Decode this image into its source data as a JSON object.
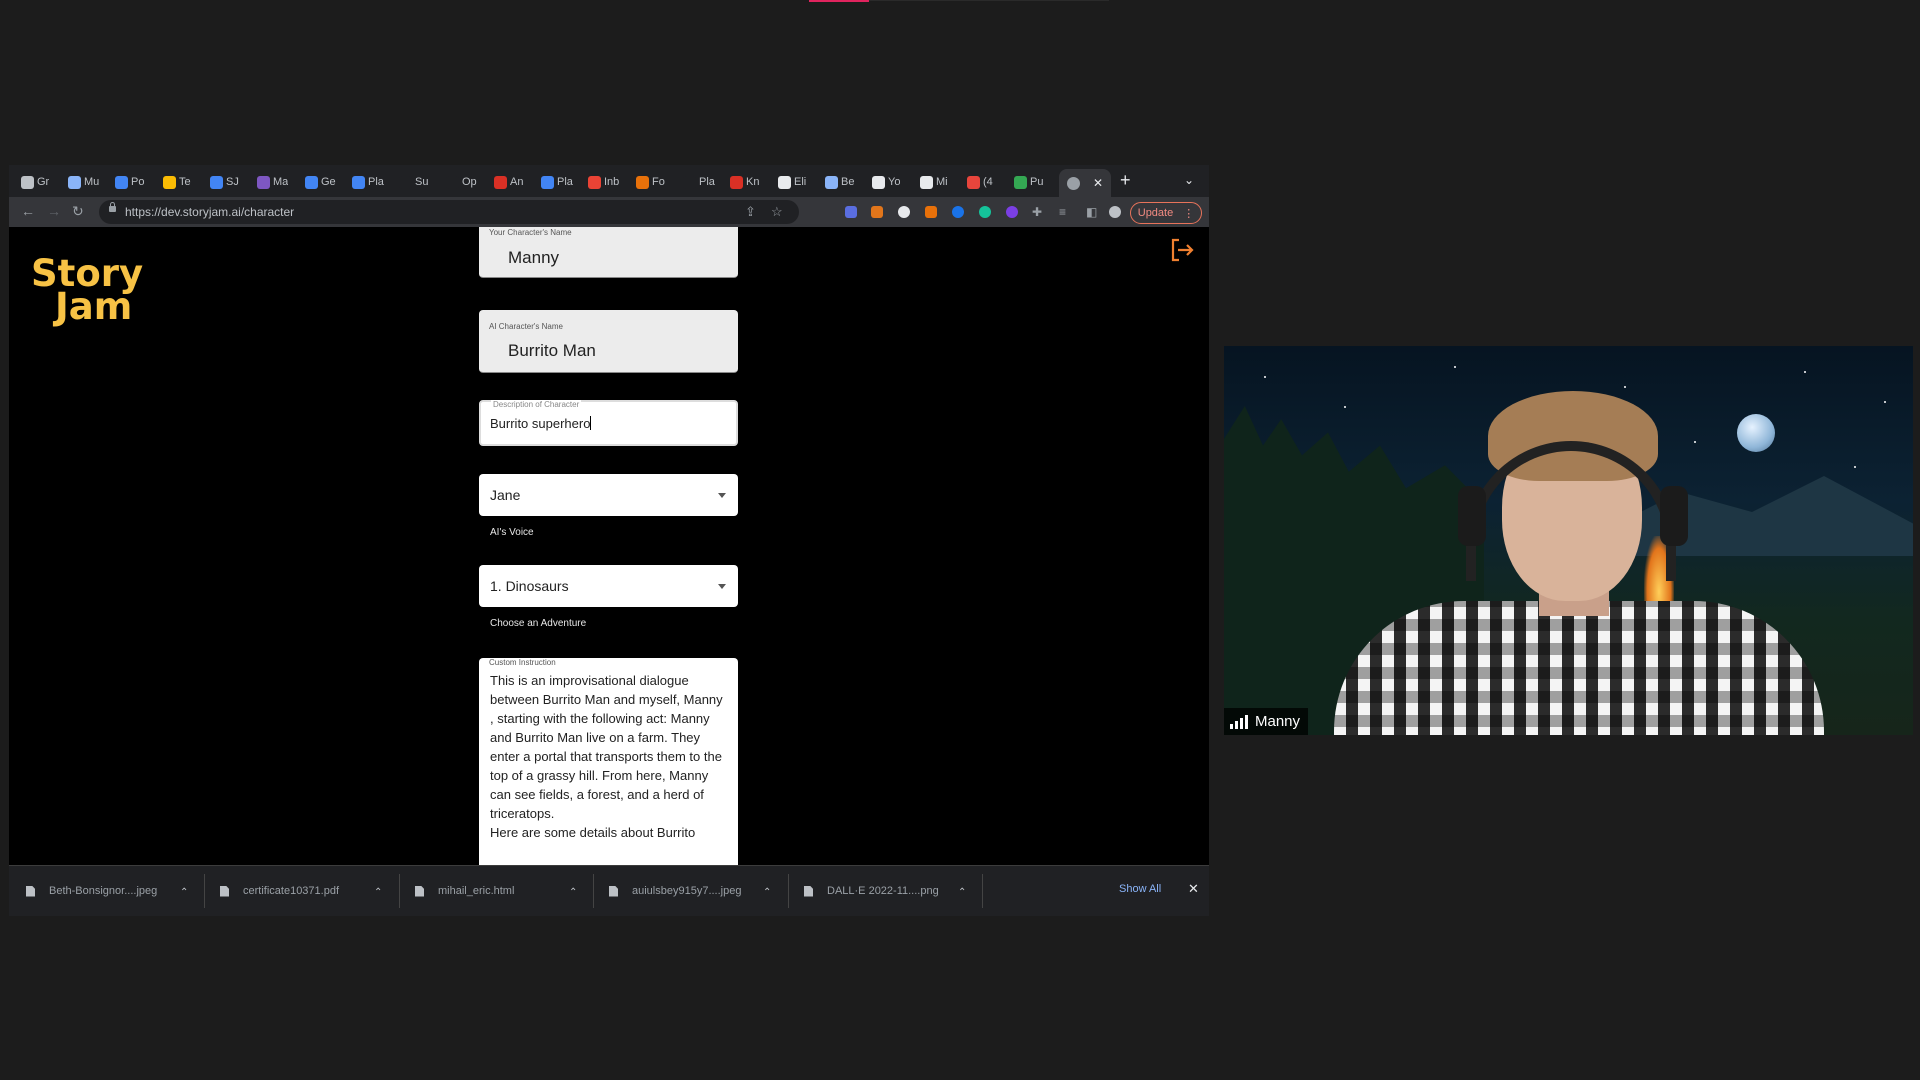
{
  "browser": {
    "tabs": [
      {
        "label": "Gr",
        "color": "#bdc1c6"
      },
      {
        "label": "Mu",
        "color": "#8ab4f8"
      },
      {
        "label": "Po",
        "color": "#4285f4"
      },
      {
        "label": "Te",
        "color": "#fbbc04"
      },
      {
        "label": "SJ",
        "color": "#4285f4"
      },
      {
        "label": "Ma",
        "color": "#7e57c2"
      },
      {
        "label": "Ge",
        "color": "#4285f4"
      },
      {
        "label": "Pla",
        "color": "#4285f4"
      },
      {
        "label": "Su",
        "color": "#202124"
      },
      {
        "label": "Op",
        "color": "#202124"
      },
      {
        "label": "An",
        "color": "#d93025"
      },
      {
        "label": "Pla",
        "color": "#4285f4"
      },
      {
        "label": "Inb",
        "color": "#ea4335"
      },
      {
        "label": "Fo",
        "color": "#e8710a"
      },
      {
        "label": "Pla",
        "color": "#202124"
      },
      {
        "label": "Kn",
        "color": "#d93025"
      },
      {
        "label": "Eli",
        "color": "#e8eaed"
      },
      {
        "label": "Be",
        "color": "#8ab4f8"
      },
      {
        "label": "Yo",
        "color": "#e8eaed"
      },
      {
        "label": "Mi",
        "color": "#e8eaed"
      },
      {
        "label": "(4",
        "color": "#e8453c"
      },
      {
        "label": "Pu",
        "color": "#34a853"
      }
    ],
    "url": "https://dev.storyjam.ai/character",
    "update_label": "Update"
  },
  "app": {
    "logo_line1": "Story",
    "logo_line2": "Jam",
    "accent_color": "#f7c245",
    "logout_color": "#f08030"
  },
  "form": {
    "your_name_label": "Your Character's Name",
    "your_name_value": "Manny",
    "ai_name_label": "AI Character's Name",
    "ai_name_value": "Burrito Man",
    "description_label": "Description of Character",
    "description_value": "Burrito superhero",
    "voice_value": "Jane",
    "voice_helper": "AI's Voice",
    "adventure_value": "1. Dinosaurs",
    "adventure_helper": "Choose an Adventure",
    "instruction_label": "Custom Instruction",
    "instruction_value": "This is an improvisational dialogue between Burrito Man and myself, Manny , starting with the following act: Manny  and Burrito Man live on a farm. They enter a portal that transports them to the top of a grassy hill. From here, Manny  can see fields, a forest, and a herd of triceratops.\nHere are some details about Burrito"
  },
  "downloads": {
    "items": [
      {
        "name": "Beth-Bonsignor....jpeg"
      },
      {
        "name": "certificate10371.pdf"
      },
      {
        "name": "mihail_eric.html"
      },
      {
        "name": "auiulsbey915y7....jpeg"
      },
      {
        "name": "DALL·E 2022-11....png"
      }
    ],
    "show_all": "Show All"
  },
  "video": {
    "participant_name": "Manny"
  }
}
